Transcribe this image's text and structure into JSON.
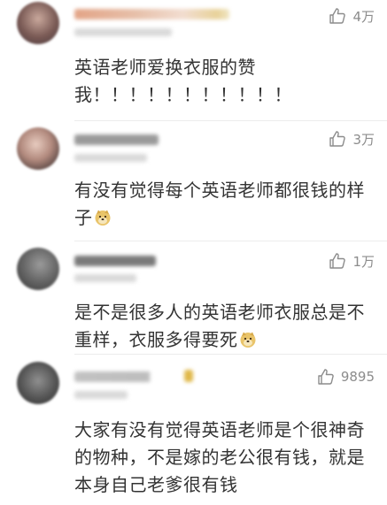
{
  "colors": {
    "text": "#333333",
    "meta": "#8c8c8c",
    "divider": "#ececec"
  },
  "comments": [
    {
      "likes": "4万",
      "lines": [
        "英语老师爱换衣服的赞",
        "我！！！！！！！！！！！"
      ],
      "emoji": false
    },
    {
      "likes": "3万",
      "lines": [
        "有没有觉得每个英语老师都很钱的样",
        "子"
      ],
      "emoji": true
    },
    {
      "likes": "1万",
      "lines": [
        "是不是很多人的英语老师衣服总是不",
        "重样，衣服多得要死"
      ],
      "emoji": true
    },
    {
      "likes": "9895",
      "lines": [
        "大家有没有觉得英语老师是个很神奇",
        "的物种，不是嫁的老公很有钱，就是",
        "本身自己老爹很有钱"
      ],
      "emoji": false
    }
  ]
}
